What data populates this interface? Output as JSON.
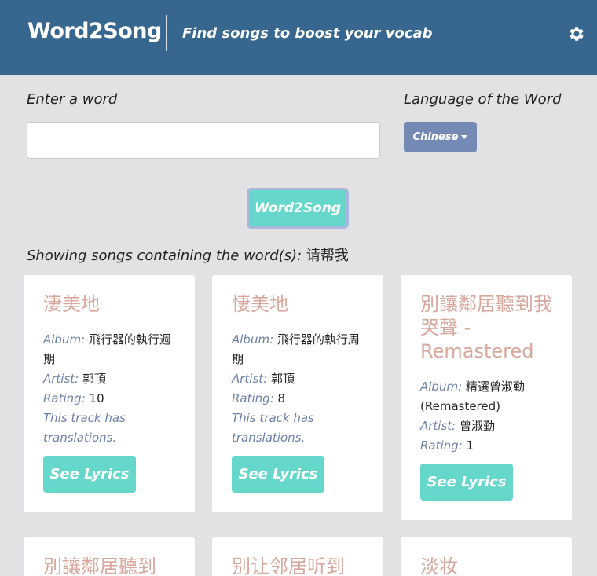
{
  "header": {
    "logo": "Word2Song",
    "tagline": "Find songs to boost your vocab",
    "settings_icon": "gear-icon"
  },
  "form": {
    "word_label": "Enter a word",
    "word_value": "",
    "language_label": "Language of the Word",
    "language_selected": "Chinese",
    "submit_label": "Word2Song"
  },
  "results": {
    "showing_prefix": "Showing songs containing the word(s):",
    "query": "请帮我"
  },
  "labels": {
    "album": "Album:",
    "artist": "Artist:",
    "rating": "Rating:",
    "see_lyrics": "See Lyrics"
  },
  "cards": [
    {
      "title": "淒美地",
      "album": "飛行器的執行週期",
      "artist": "郭頂",
      "rating": "10",
      "translation_note": "This track has translations."
    },
    {
      "title": "悽美地",
      "album": "飛行器的執行周期",
      "artist": "郭頂",
      "rating": "8",
      "translation_note": "This track has translations."
    },
    {
      "title": "別讓鄰居聽到我哭聲 - Remastered",
      "album": "精選曾淑勤 (Remastered)",
      "artist": "曾淑勤",
      "rating": "1",
      "translation_note": ""
    },
    {
      "title": "別讓鄰居聽到"
    },
    {
      "title": "别让邻居听到"
    },
    {
      "title": "淡妆"
    }
  ],
  "colors": {
    "header_bg": "#37668f",
    "page_bg": "#e2e1e4",
    "accent_teal": "#66d8cb",
    "title_pink": "#d8a79c",
    "label_blue": "#6c7fa8",
    "dropdown_bg": "#7489b3"
  }
}
